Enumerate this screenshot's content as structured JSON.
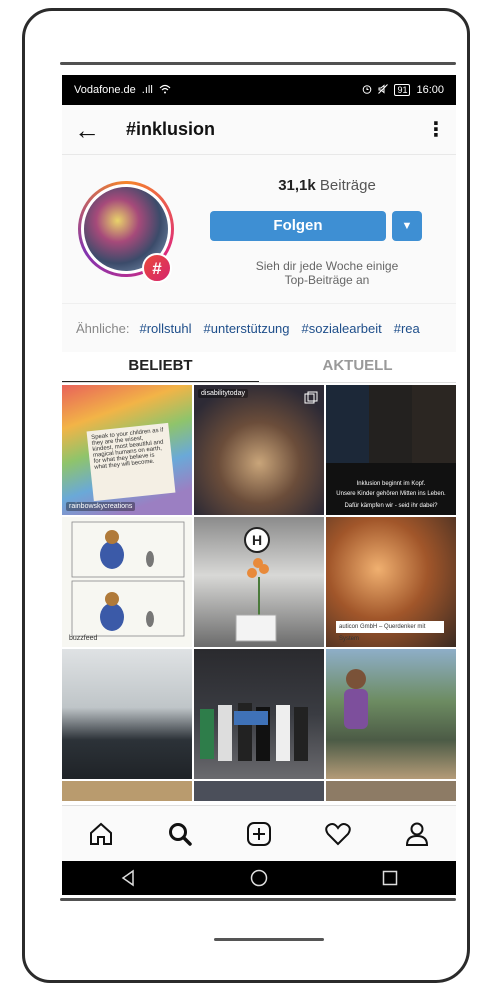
{
  "statusbar": {
    "carrier": "Vodafone.de",
    "signal_text": ".ıll",
    "battery": "91",
    "time": "16:00"
  },
  "topbar": {
    "back": "←",
    "title": "#inklusion",
    "more": "⋮"
  },
  "header": {
    "posts_count": "31,1k",
    "posts_label": "Beiträge",
    "follow_label": "Folgen",
    "dropdown_symbol": "▼",
    "hint_line1": "Sieh dir jede Woche einige",
    "hint_line2": "Top-Beiträge an",
    "badge": "#"
  },
  "related": {
    "label": "Ähnliche:",
    "tags": [
      "#rollstuhl",
      "#unterstützung",
      "#sozialearbeit",
      "#rea"
    ]
  },
  "tabs": [
    {
      "label": "BELIEBT"
    },
    {
      "label": "AKTUELL"
    }
  ],
  "posts": [
    {
      "caption": "rainbowskycreations",
      "card_text": "Speak to your children as if they are the wisest, kindest, most beautiful and magical humans on earth, for what they believe is what they will become."
    },
    {
      "caption": "disabilitytoday"
    },
    {
      "lines": [
        "Inklusion beginnt im Kopf.",
        "Unsere Kinder gehören Mitten ins Leben.",
        "Dafür kämpfen wir - seid ihr dabei?"
      ]
    },
    {
      "caption": "buzzfeed"
    },
    {
      "sign": "H"
    },
    {
      "pill": "auticon GmbH – Querdenker mit System"
    },
    {},
    {},
    {}
  ],
  "colors": {
    "accent": "#3e8fd3",
    "tag": "#1e4e8a"
  }
}
